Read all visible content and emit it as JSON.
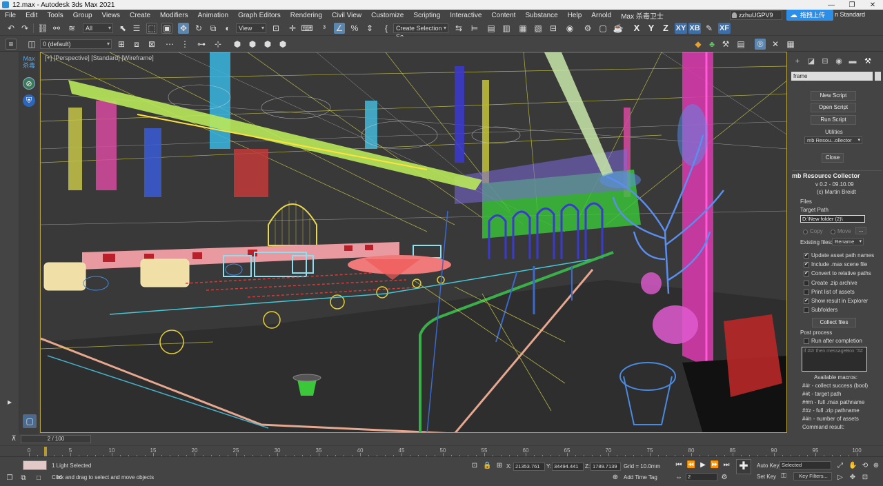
{
  "window": {
    "title": "12.max - Autodesk 3ds Max 2021",
    "controls": [
      "—",
      "❐",
      "✕"
    ]
  },
  "menu": {
    "items": [
      "File",
      "Edit",
      "Tools",
      "Group",
      "Views",
      "Create",
      "Modifiers",
      "Animation",
      "Graph Editors",
      "Rendering",
      "Civil View",
      "Customize",
      "Scripting",
      "Interactive",
      "Content",
      "Substance",
      "Help",
      "Arnold",
      "Max 杀毒卫士"
    ],
    "user": "zzhuUGPV9",
    "upload_label": "拖拽上传",
    "workspace": "n Standard"
  },
  "toolbar": {
    "selection_filter": "All",
    "ref_coord": "View",
    "named_selection": "Create Selection Se",
    "axis_x": "X",
    "axis_y": "Y",
    "axis_z": "Z",
    "axis_xy": "XY",
    "axis_xb": "XB",
    "axis_xf": "XF",
    "layer": "0 (default)"
  },
  "leftstrip": {
    "badge_line1": "Max",
    "badge_line2": "杀毒"
  },
  "viewport": {
    "label": "[+] [Perspective] [Standard] [Wireframe]"
  },
  "command_panel": {
    "search": "frame",
    "buttons": {
      "new_script": "New Script",
      "open_script": "Open Script",
      "run_script": "Run Script",
      "close": "Close",
      "collect_files": "Collect files"
    },
    "utilities_label": "Utilities",
    "utilities_dropdown": "mb Resou...ollector",
    "rollout_title": "mb Resource Collector",
    "version": "v 0.2 - 09.10.09",
    "author": "(c) Martin Breidt",
    "files_label": "Files",
    "target_path_label": "Target Path",
    "target_path_value": "D:\\New folder (2)\\",
    "copy_label": "Copy",
    "move_label": "Move",
    "ellipsis": "...",
    "existing_files_label": "Existing files:",
    "existing_files_value": "Rename",
    "options": [
      {
        "label": "Update asset path names",
        "checked": true
      },
      {
        "label": "Include .max scene file",
        "checked": true
      },
      {
        "label": "Convert to relative paths",
        "checked": true
      },
      {
        "label": "Create .zip archive",
        "checked": false
      },
      {
        "label": "Print list of assets",
        "checked": false
      },
      {
        "label": "Show result in Explorer",
        "checked": true
      },
      {
        "label": "Subfolders",
        "checked": false
      }
    ],
    "post_process_label": "Post process",
    "run_after_label": "Run after completion",
    "script_placeholder": "if ##r then messageBox \"##",
    "macros_label": "Available macros:",
    "macros": [
      "##r - collect success (bool)",
      "##t - target path",
      "##m - full .max pathname",
      "##z - full .zip pathname",
      "##n - number of assets"
    ],
    "command_result_label": "Command result:"
  },
  "timeline": {
    "frame_display": "2 / 100",
    "ticks": [
      0,
      5,
      10,
      15,
      20,
      25,
      30,
      35,
      40,
      45,
      50,
      55,
      60,
      65,
      70,
      75,
      80,
      85,
      90,
      95,
      100
    ],
    "current_frame": 2,
    "total_frames": 100
  },
  "status": {
    "selection": "1 Light Selected",
    "prompt": "Click and drag to select and move objects",
    "x_label": "X:",
    "x_value": "21353.761",
    "y_label": "Y:",
    "y_value": "34494.441",
    "z_label": "Z:",
    "z_value": "1789.7139",
    "grid": "Grid = 10.0mm",
    "add_time_tag": "Add Time Tag",
    "auto_key": "Auto Key",
    "set_key": "Set Key",
    "selected": "Selected",
    "key_filters": "Key Filters...",
    "frame_field": "2"
  }
}
